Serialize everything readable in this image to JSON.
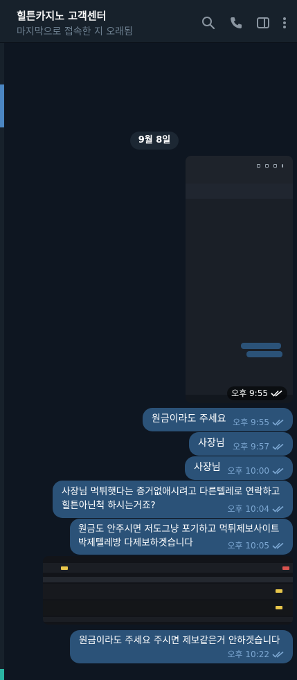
{
  "header": {
    "title": "힐튼카지노 고객센터",
    "subtitle": "마지막으로 접속한 지 오래됨"
  },
  "colors": {
    "background": "#0e1621",
    "header": "#17212b",
    "outgoing_bubble": "#2b5278",
    "meta_text": "#7da8d3",
    "accent": "#4b86c2"
  },
  "icons": [
    "search-icon",
    "phone-icon",
    "sidebar-icon",
    "more-vert-icon"
  ],
  "date_separator": "9월 8일",
  "image_messages": [
    {
      "time": "오후 9:55"
    }
  ],
  "messages": [
    {
      "lines": [
        "원금이라도 주세요"
      ],
      "time": "오후 9:55"
    },
    {
      "lines": [
        "사장님"
      ],
      "time": "오후 9:57"
    },
    {
      "lines": [
        "사장님"
      ],
      "time": "오후 10:00"
    },
    {
      "lines": [
        "사장님 먹튀햇다는 증거없애시려고 다른텔레로 연락하고",
        "힐튼아닌척 하시는거죠?"
      ],
      "time": "오후 10:04"
    },
    {
      "lines": [
        "원금도 안주시면 저도그냥 포기하고 먹튀제보사이트",
        "박제텔레방 다제보하겟습니다"
      ],
      "time": "오후 10:05"
    },
    {
      "lines": [
        "원금이라도 주세요 주시면 제보같은거 안하겟습니다"
      ],
      "time": "오후 10:22"
    }
  ]
}
